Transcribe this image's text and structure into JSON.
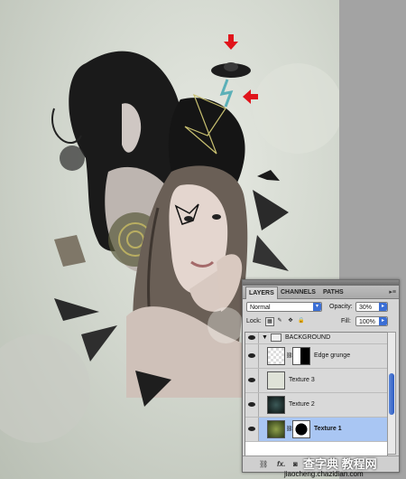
{
  "panel": {
    "tabs": [
      "LAYERS",
      "CHANNELS",
      "PATHS"
    ],
    "menu_icon": "panel-menu-icon",
    "blend_mode": "Normal",
    "opacity_label": "Opacity:",
    "opacity_value": "30%",
    "lock_label": "Lock:",
    "fill_label": "Fill:",
    "fill_value": "100%",
    "layers": [
      {
        "name": "BACKGROUND",
        "type": "group"
      },
      {
        "name": "Edge grunge",
        "type": "layer-mask"
      },
      {
        "name": "Texture 3",
        "type": "layer"
      },
      {
        "name": "Texture 2",
        "type": "layer"
      },
      {
        "name": "Texture 1",
        "type": "layer-mask",
        "selected": true
      }
    ],
    "bottom_icons": [
      "link-icon",
      "fx-icon",
      "mask-icon",
      "adjustment-icon",
      "folder-icon",
      "new-layer-icon",
      "trash-icon"
    ],
    "fx_label": "fx."
  },
  "watermark": {
    "text": "查字典 教程网",
    "url": "jiaocheng.chazidian.com"
  },
  "colors": {
    "selection": "#a9c6f3",
    "arrow": "#e0141b",
    "scroll": "#2f5ec3"
  }
}
